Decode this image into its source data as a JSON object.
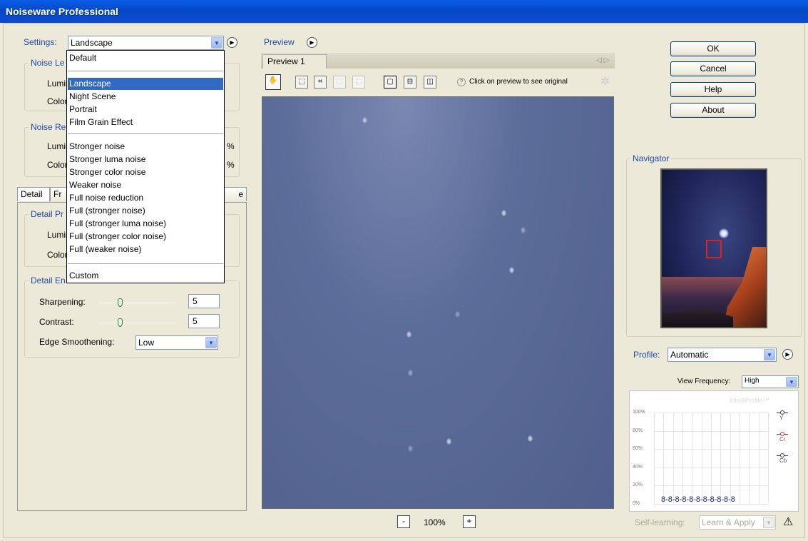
{
  "window": {
    "title": "Noiseware Professional"
  },
  "settings": {
    "label": "Settings:",
    "value": "Landscape",
    "menu": {
      "items": [
        {
          "label": "Default",
          "selected": false
        },
        {
          "label": "Landscape",
          "selected": true
        },
        {
          "label": "Night Scene",
          "selected": false
        },
        {
          "label": "Portrait",
          "selected": false
        },
        {
          "label": "Film Grain Effect",
          "selected": false
        },
        {
          "label": "Stronger noise",
          "selected": false
        },
        {
          "label": "Stronger luma noise",
          "selected": false
        },
        {
          "label": "Stronger color noise",
          "selected": false
        },
        {
          "label": "Weaker noise",
          "selected": false
        },
        {
          "label": "Full noise reduction",
          "selected": false
        },
        {
          "label": "Full (stronger noise)",
          "selected": false
        },
        {
          "label": "Full (stronger luma noise)",
          "selected": false
        },
        {
          "label": "Full (stronger color noise)",
          "selected": false
        },
        {
          "label": "Full (weaker noise)",
          "selected": false
        },
        {
          "label": "Custom",
          "selected": false
        }
      ]
    }
  },
  "left_panel": {
    "noise_level_legend": "Noise Le",
    "noise_level_luma": "Lumin",
    "noise_level_color": "Color:",
    "noise_reduction_legend": "Noise Re",
    "noise_reduction_luma": "Lumin",
    "noise_reduction_color": "Color:",
    "pct1": "%",
    "pct2": "%",
    "tabs": {
      "detail": "Detail",
      "freq": "Fr",
      "tail": "e"
    },
    "detail_protection_legend": "Detail Pr",
    "detail_protection_luma": "Lumin",
    "detail_protection_color": "Color:",
    "detail_enhancement_legend": "Detail En",
    "sharpening_label": "Sharpening:",
    "sharpening_value": "5",
    "contrast_label": "Contrast:",
    "contrast_value": "5",
    "edge_label": "Edge Smoothening:",
    "edge_value": "Low"
  },
  "preview": {
    "legend": "Preview",
    "tab_label": "Preview 1",
    "tab_nav": "◁ ▷",
    "help_mark": "?",
    "hint": "Click on preview to see original",
    "zoom_minus": "-",
    "zoom_value": "100%",
    "zoom_plus": "+"
  },
  "buttons": {
    "ok": "OK",
    "cancel": "Cancel",
    "help": "Help",
    "about": "About"
  },
  "navigator": {
    "legend": "Navigator"
  },
  "profile": {
    "label": "Profile:",
    "value": "Automatic",
    "view_freq_label": "View Frequency:",
    "view_freq_value": "High",
    "graph_watermark": "IntelliProfile™",
    "y_ticks": [
      "100%",
      "80%",
      "60%",
      "40%",
      "20%",
      "0%"
    ],
    "channels": [
      {
        "name": "Y",
        "color": "#333333"
      },
      {
        "name": "Cr",
        "color": "#d03030"
      },
      {
        "name": "Cb",
        "color": "#3030a0"
      }
    ],
    "bars_text": "8-8-8-8-8-8-8-8-8-8-8",
    "self_learning_label": "Self-learning:",
    "learn_value": "Learn & Apply",
    "warn": "⚠"
  }
}
